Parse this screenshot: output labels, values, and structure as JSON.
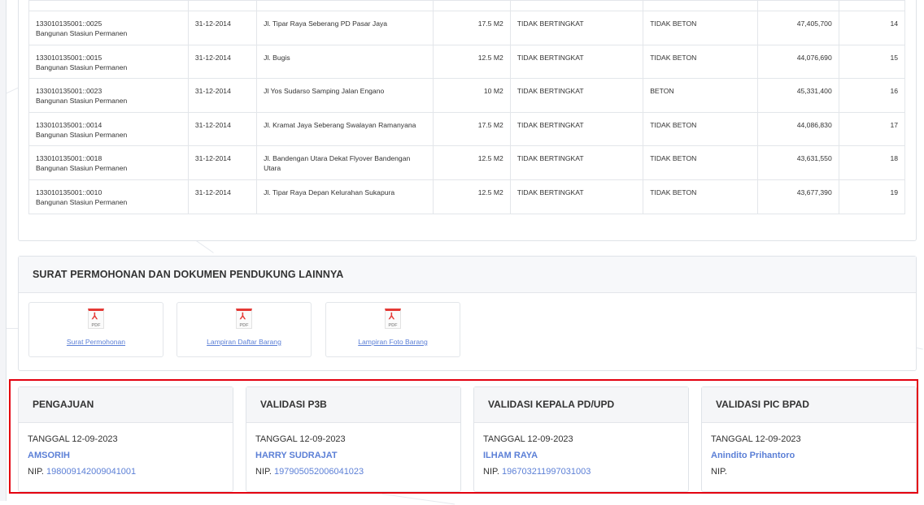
{
  "table": {
    "rows": [
      {
        "code": "133010135001::0025",
        "desc": "Bangunan Stasiun Permanen",
        "date": "31-12-2014",
        "address": "Jl. Tipar Raya Seberang PD Pasar Jaya",
        "area": "17.5 M2",
        "level": "TIDAK BERTINGKAT",
        "concrete": "TIDAK BETON",
        "value": "47,405,700",
        "no": "14"
      },
      {
        "code": "133010135001::0015",
        "desc": "Bangunan Stasiun Permanen",
        "date": "31-12-2014",
        "address": "Jl. Bugis",
        "area": "12.5 M2",
        "level": "TIDAK BERTINGKAT",
        "concrete": "TIDAK BETON",
        "value": "44,076,690",
        "no": "15"
      },
      {
        "code": "133010135001::0023",
        "desc": "Bangunan Stasiun Permanen",
        "date": "31-12-2014",
        "address": "Jl Yos Sudarso Samping Jalan Engano",
        "area": "10 M2",
        "level": "TIDAK BERTINGKAT",
        "concrete": "BETON",
        "value": "45,331,400",
        "no": "16"
      },
      {
        "code": "133010135001::0014",
        "desc": "Bangunan Stasiun Permanen",
        "date": "31-12-2014",
        "address": "Jl. Kramat Jaya Seberang Swalayan Ramanyana",
        "area": "17.5 M2",
        "level": "TIDAK BERTINGKAT",
        "concrete": "TIDAK BETON",
        "value": "44,086,830",
        "no": "17"
      },
      {
        "code": "133010135001::0018",
        "desc": "Bangunan Stasiun Permanen",
        "date": "31-12-2014",
        "address": "Jl. Bandengan Utara Dekat Flyover Bandengan Utara",
        "area": "12.5 M2",
        "level": "TIDAK BERTINGKAT",
        "concrete": "TIDAK BETON",
        "value": "43,631,550",
        "no": "18"
      },
      {
        "code": "133010135001::0010",
        "desc": "Bangunan Stasiun Permanen",
        "date": "31-12-2014",
        "address": "Jl. Tipar Raya Depan Kelurahan Sukapura",
        "area": "12.5 M2",
        "level": "TIDAK BERTINGKAT",
        "concrete": "TIDAK BETON",
        "value": "43,677,390",
        "no": "19"
      }
    ]
  },
  "docs": {
    "title": "SURAT PERMOHONAN DAN DOKUMEN PENDUKUNG LAINNYA",
    "pdf_label": "PDF",
    "items": [
      {
        "label": "Surat Permohonan",
        "icon": "pdf-icon"
      },
      {
        "label": "Lampiran Daftar Barang",
        "icon": "pdf-icon"
      },
      {
        "label": "Lampiran Foto Barang",
        "icon": "pdf-icon"
      }
    ]
  },
  "validation": [
    {
      "title": "PENGAJUAN",
      "date": "TANGGAL 12-09-2023",
      "name": "AMSORIH",
      "nip_label": "NIP.",
      "nip": "198009142009041001"
    },
    {
      "title": "VALIDASI P3B",
      "date": "TANGGAL 12-09-2023",
      "name": "HARRY SUDRAJAT",
      "nip_label": "NIP.",
      "nip": "197905052006041023"
    },
    {
      "title": "VALIDASI KEPALA PD/UPD",
      "date": "TANGGAL 12-09-2023",
      "name": "ILHAM RAYA",
      "nip_label": "NIP.",
      "nip": "196703211997031003"
    },
    {
      "title": "VALIDASI PIC BPAD",
      "date": "TANGGAL 12-09-2023",
      "name": "Anindito Prihantoro",
      "nip_label": "NIP.",
      "nip": ""
    }
  ],
  "colors": {
    "accent": "#5b7fd6",
    "highlight": "#e3000f",
    "pdf": "#e53935"
  }
}
